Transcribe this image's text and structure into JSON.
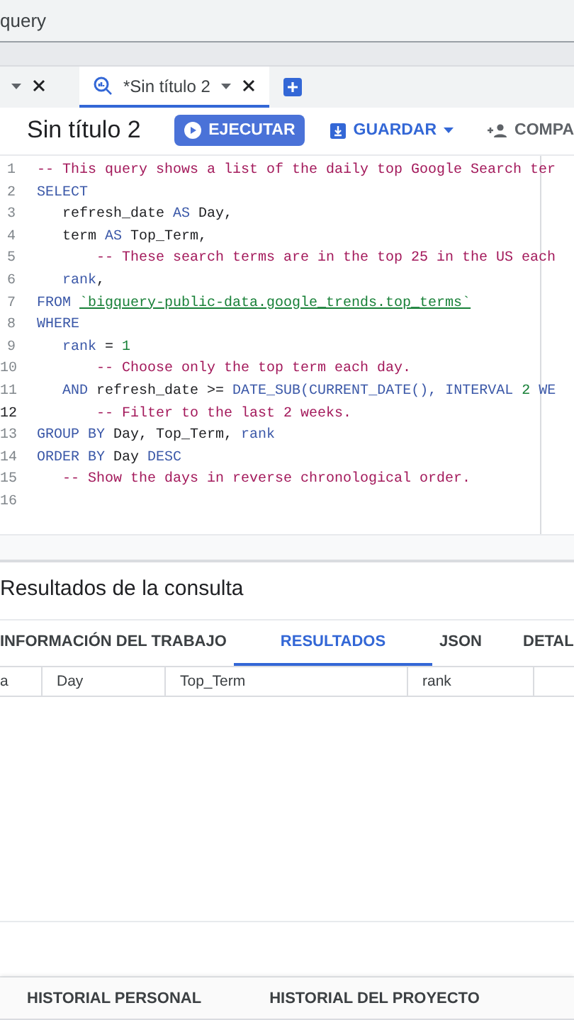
{
  "search_field": {
    "value": "query"
  },
  "editor_tabs": [
    {
      "selected": false
    },
    {
      "label": "*Sin título 2",
      "selected": true
    }
  ],
  "toolbar": {
    "title": "Sin título 2",
    "run_button": "EJECUTAR",
    "save_button": "GUARDAR",
    "share_button": "COMPA"
  },
  "code_lines": [
    {
      "number": "1",
      "current": false,
      "tokens": [
        {
          "kind": "comment",
          "text": "-- This query shows a list of the daily top Google Search ter"
        }
      ]
    },
    {
      "number": "2",
      "current": false,
      "tokens": [
        {
          "kind": "keyword",
          "text": "SELECT"
        }
      ]
    },
    {
      "number": "3",
      "current": false,
      "tokens": [
        {
          "kind": "plain",
          "text": "   refresh_date "
        },
        {
          "kind": "keyword",
          "text": "AS"
        },
        {
          "kind": "plain",
          "text": " Day,"
        }
      ]
    },
    {
      "number": "4",
      "current": false,
      "tokens": [
        {
          "kind": "plain",
          "text": "   term "
        },
        {
          "kind": "keyword",
          "text": "AS"
        },
        {
          "kind": "plain",
          "text": " Top_Term,"
        }
      ]
    },
    {
      "number": "5",
      "current": false,
      "tokens": [
        {
          "kind": "comment",
          "text": "       -- These search terms are in the top 25 in the US each"
        }
      ]
    },
    {
      "number": "6",
      "current": false,
      "tokens": [
        {
          "kind": "keyword",
          "text": "   rank"
        },
        {
          "kind": "plain",
          "text": ","
        }
      ]
    },
    {
      "number": "7",
      "current": false,
      "tokens": [
        {
          "kind": "keyword",
          "text": "FROM "
        },
        {
          "kind": "string",
          "text": "`bigquery-public-data.google_trends.top_terms`"
        }
      ]
    },
    {
      "number": "8",
      "current": false,
      "tokens": [
        {
          "kind": "keyword",
          "text": "WHERE"
        }
      ]
    },
    {
      "number": "9",
      "current": false,
      "tokens": [
        {
          "kind": "keyword",
          "text": "   rank"
        },
        {
          "kind": "plain",
          "text": " = "
        },
        {
          "kind": "number",
          "text": "1"
        }
      ]
    },
    {
      "number": "10",
      "current": false,
      "tokens": [
        {
          "kind": "comment",
          "text": "       -- Choose only the top term each day."
        }
      ]
    },
    {
      "number": "11",
      "current": false,
      "tokens": [
        {
          "kind": "keyword",
          "text": "   AND"
        },
        {
          "kind": "plain",
          "text": " refresh_date >= "
        },
        {
          "kind": "keyword",
          "text": "DATE_SUB(CURRENT_DATE(), INTERVAL "
        },
        {
          "kind": "number",
          "text": "2"
        },
        {
          "kind": "keyword",
          "text": " WE"
        }
      ]
    },
    {
      "number": "12",
      "current": true,
      "tokens": [
        {
          "kind": "comment",
          "text": "       -- Filter to the last 2 weeks."
        }
      ]
    },
    {
      "number": "13",
      "current": false,
      "tokens": [
        {
          "kind": "keyword",
          "text": "GROUP BY"
        },
        {
          "kind": "plain",
          "text": " Day, Top_Term, "
        },
        {
          "kind": "keyword",
          "text": "rank"
        }
      ]
    },
    {
      "number": "14",
      "current": false,
      "tokens": [
        {
          "kind": "keyword",
          "text": "ORDER BY"
        },
        {
          "kind": "plain",
          "text": " Day "
        },
        {
          "kind": "keyword",
          "text": "DESC"
        }
      ]
    },
    {
      "number": "15",
      "current": false,
      "tokens": [
        {
          "kind": "comment",
          "text": "   -- Show the days in reverse chronological order."
        }
      ]
    },
    {
      "number": "16",
      "current": false
    }
  ],
  "results": {
    "title": "Resultados de la consulta",
    "tabs": [
      {
        "label": "INFORMACIÓN DEL TRABAJO",
        "selected": false
      },
      {
        "label": "RESULTADOS",
        "selected": true
      },
      {
        "label": "JSON",
        "selected": false
      },
      {
        "label": "DETAL",
        "selected": false
      }
    ],
    "columns": [
      "a",
      "Day",
      "Top_Term",
      "rank"
    ]
  },
  "history_tabs": [
    "HISTORIAL PERSONAL",
    "HISTORIAL DEL PROYECTO"
  ]
}
